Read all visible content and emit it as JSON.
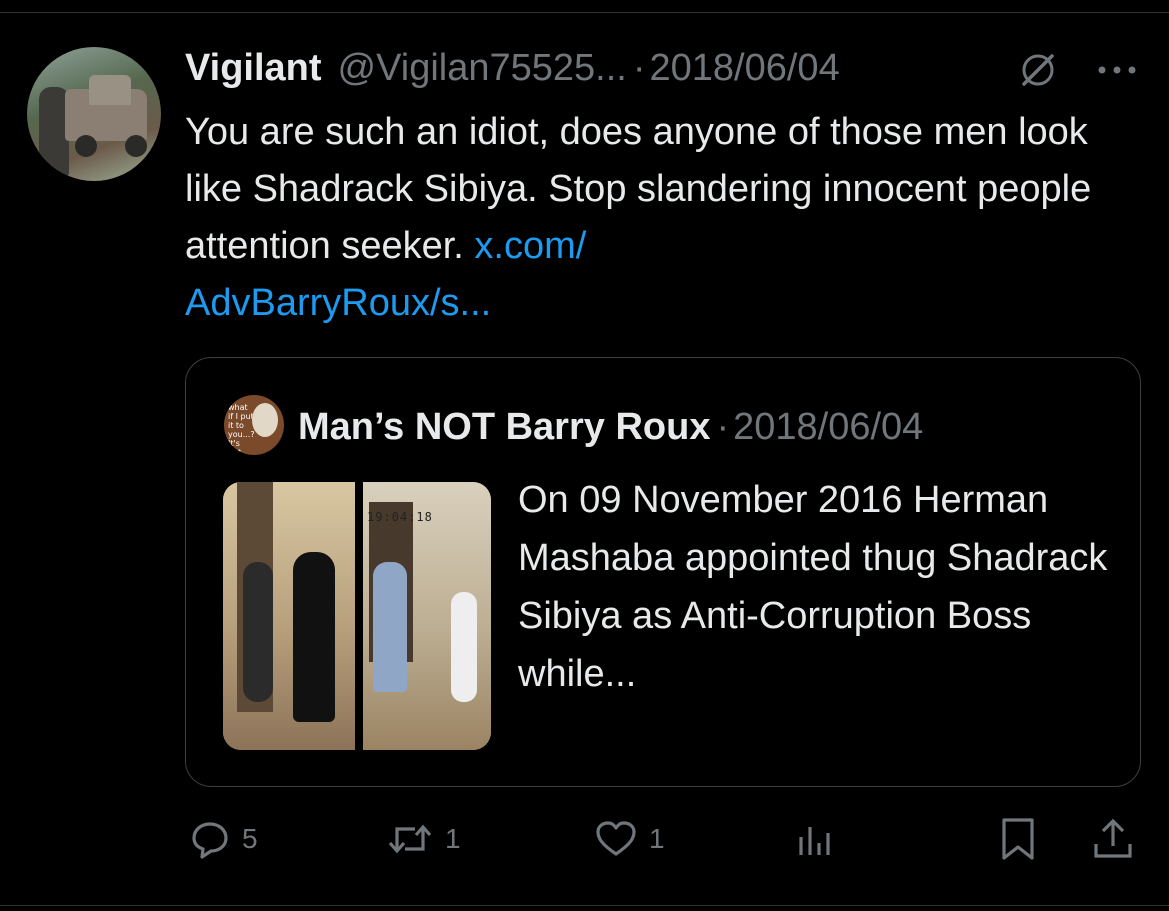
{
  "tweet": {
    "display_name": "Vigilant",
    "handle": "@Vigilan75525...",
    "separator": "·",
    "date": "2018/06/04",
    "text": "You are such an idiot, does anyone of those men look like Shadrack Sibiya. Stop slandering innocent people attention seeker.",
    "link_text": "x.com/\nAdvBarryRoux/s..."
  },
  "quoted": {
    "display_name": "Man’s NOT Barry Roux",
    "separator": "·",
    "date": "2018/06/04",
    "text": "On 09 November 2016 Herman Mashaba appointed thug Shadrack Sibiya as Anti-Corruption Boss while...",
    "avatar_text": "what if I put it to you...? It's not",
    "thumbnail_timestamp": "19:04:18"
  },
  "actions": {
    "replies": "5",
    "reposts": "1",
    "likes": "1"
  },
  "icons": {
    "grok": "grok-icon",
    "more": "more-icon",
    "reply": "reply-icon",
    "repost": "repost-icon",
    "like": "heart-icon",
    "views": "views-icon",
    "bookmark": "bookmark-icon",
    "share": "share-icon"
  },
  "colors": {
    "background": "#000000",
    "text": "#e7e9ea",
    "muted": "#71767b",
    "link": "#1d9bf0",
    "border": "#3a3f44"
  }
}
